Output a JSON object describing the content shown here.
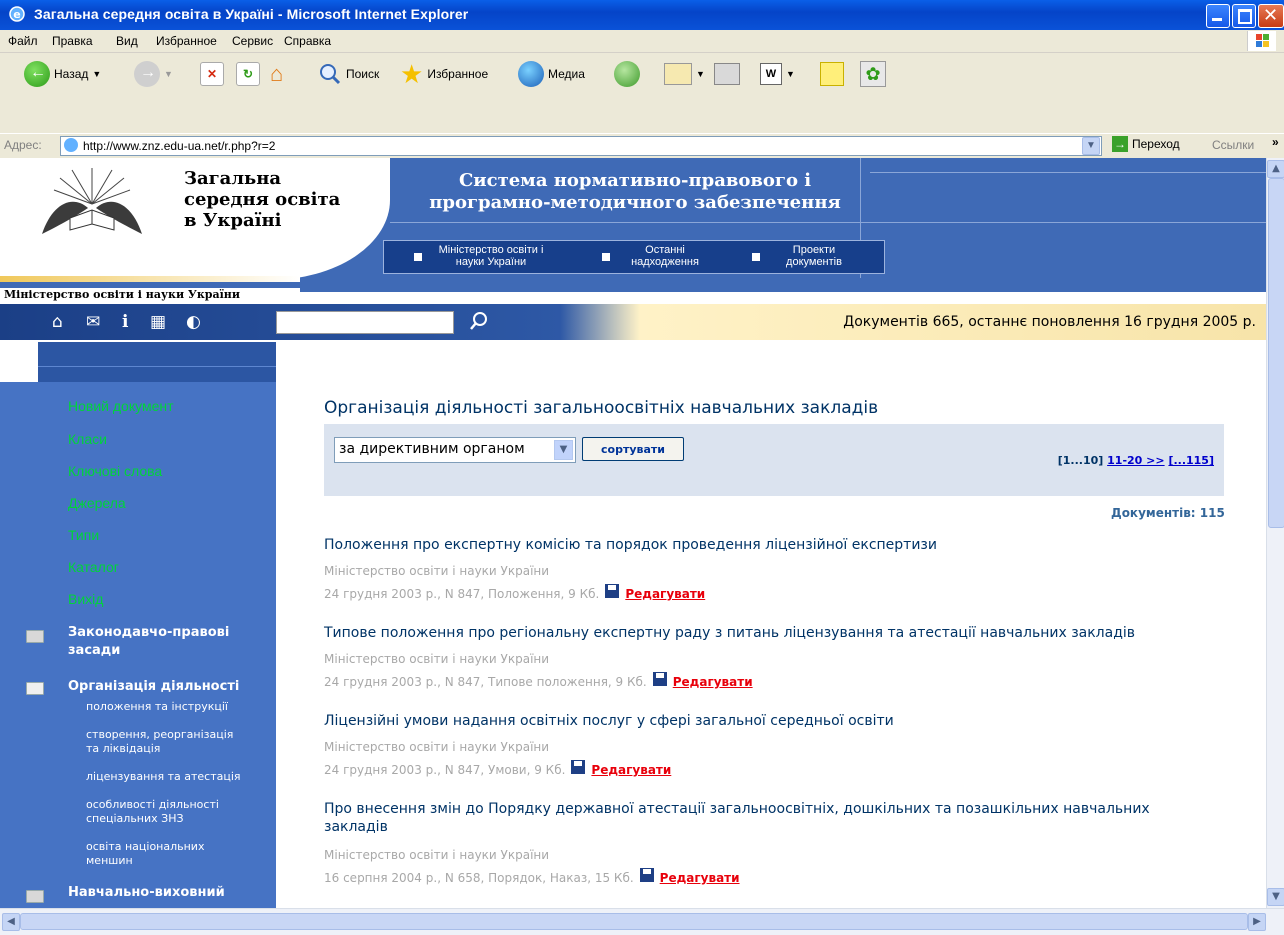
{
  "window": {
    "title": "Загальна середня освіта в Україні - Microsoft Internet Explorer"
  },
  "menu": [
    "Файл",
    "Правка",
    "Вид",
    "Избранное",
    "Сервис",
    "Справка"
  ],
  "toolbar": {
    "back": "Назад",
    "search": "Поиск",
    "favorites": "Избранное",
    "media": "Медиа"
  },
  "address": {
    "label": "Адрес:",
    "url": "http://www.znz.edu-ua.net/r.php?r=2",
    "go": "Переход",
    "links": "Ссылки"
  },
  "site": {
    "logo_line1": "Загальна",
    "logo_line2": "середня освіта",
    "logo_line3": "в Україні",
    "title_line1": "Система нормативно-правового і",
    "title_line2": "програмно-методичного забезпечення",
    "ministry": "Міністерство освіти і науки України",
    "nav": [
      {
        "line1": "Міністерство освіти і",
        "line2": "науки України"
      },
      {
        "line1": "Останні",
        "line2": "надходження"
      },
      {
        "line1": "Проекти",
        "line2": "документів"
      }
    ],
    "status": "Документів 665, останнє поновлення 16 грудня 2005 р."
  },
  "sidebar": {
    "links": [
      "Новий документ",
      "Класи",
      "Ключові слова",
      "Джерела",
      "Типи",
      "Каталог",
      "Вихід"
    ],
    "sections": [
      {
        "label_line1": "Законодавчо-правові",
        "label_line2": "засади"
      },
      {
        "label_line1": "Організація діяльності",
        "label_line2": ""
      },
      {
        "label_line1": "Навчально-виховний",
        "label_line2": ""
      }
    ],
    "subitems": [
      {
        "line1": "положення та інструкції",
        "line2": ""
      },
      {
        "line1": "створення, реорганізація",
        "line2": "та ліквідація"
      },
      {
        "line1": "ліцензування та атестація",
        "line2": ""
      },
      {
        "line1": "особливості діяльності",
        "line2": "спеціальних ЗНЗ"
      },
      {
        "line1": "освіта національних",
        "line2": "меншин"
      }
    ]
  },
  "main": {
    "title": "Організація діяльності загальноосвітніх навчальних закладів",
    "sort_value": "за директивним органом",
    "sort_button": "сортувати",
    "pager_current": "[1...10]",
    "pager_next": "11-20 >>",
    "pager_last": "[...115]",
    "doc_count": "Документів: 115",
    "edit_label": "Редагувати",
    "documents": [
      {
        "title": "Положення про експертну комісію та порядок проведення ліцензійної експертизи",
        "org": "Міністерство освіти і науки України",
        "meta": "24 грудня 2003 р., N 847, Положення, 9 Кб."
      },
      {
        "title": "Типове положення про регіональну експертну раду з питань ліцензування та атестації навчальних закладів",
        "org": "Міністерство освіти і науки України",
        "meta": "24 грудня 2003 р., N 847, Типове положення, 9 Кб."
      },
      {
        "title": "Ліцензійні умови надання освітніх послуг у сфері загальної середньої освіти",
        "org": "Міністерство освіти і науки України",
        "meta": "24 грудня 2003 р., N 847, Умови, 9 Кб."
      },
      {
        "title": "Про внесення змін до Порядку державної атестації загальноосвітніх, дошкільних та позашкільних навчальних закладів",
        "org": "Міністерство освіти і науки України",
        "meta": "16 серпня 2004 р., N 658, Порядок, Наказ, 15 Кб."
      }
    ]
  }
}
